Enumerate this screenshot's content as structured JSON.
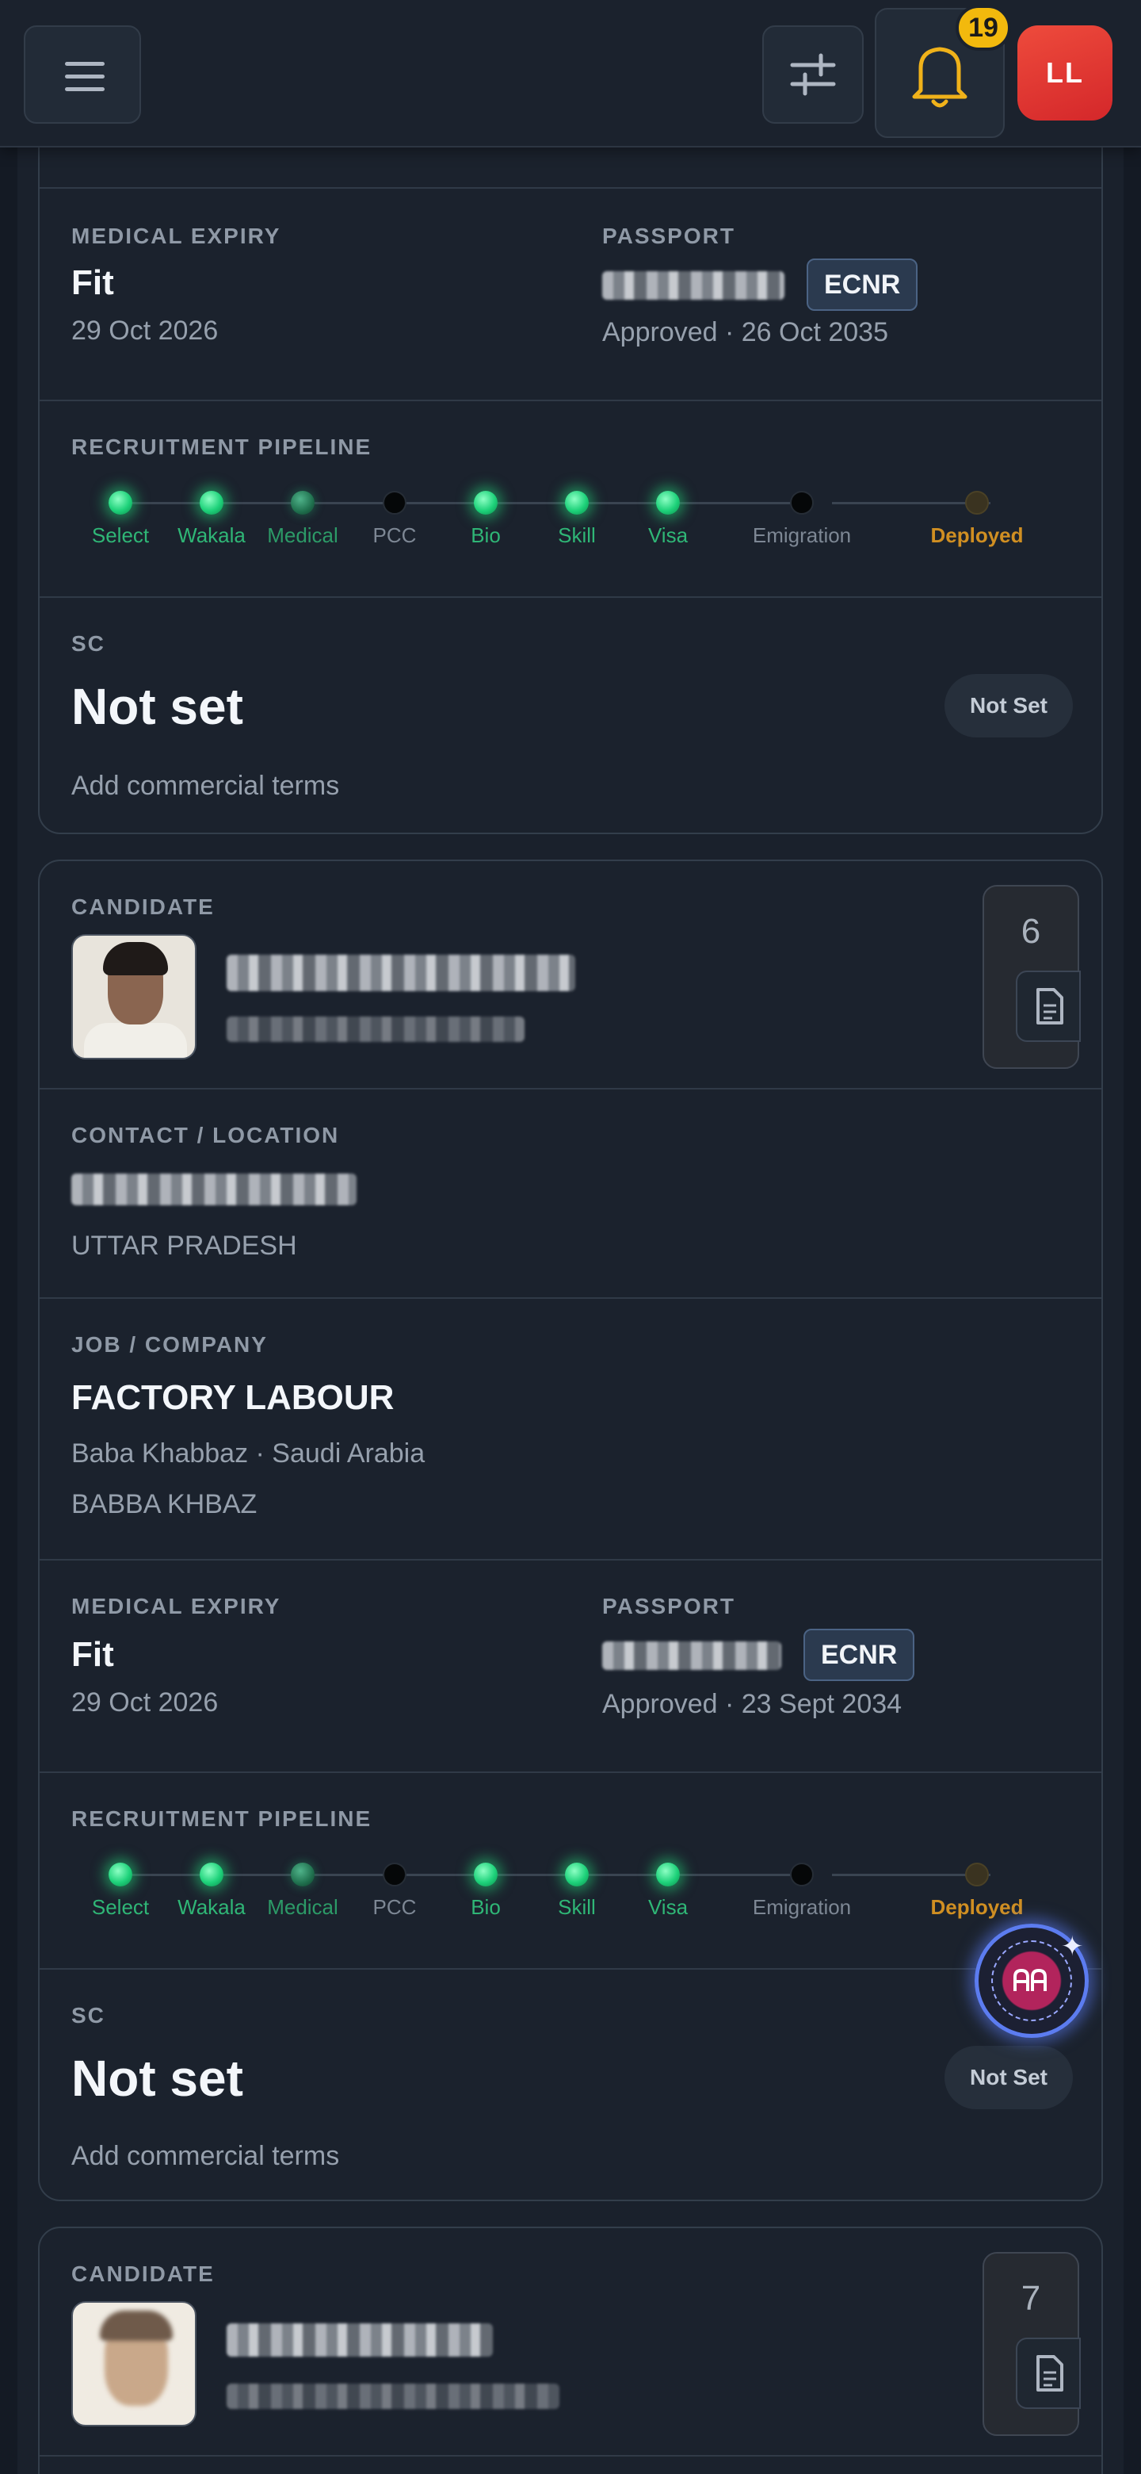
{
  "topbar": {
    "notification_count": "19",
    "avatar_initials": "LL"
  },
  "cards": [
    {
      "medical": {
        "label": "MEDICAL EXPIRY",
        "status": "Fit",
        "date": "29 Oct 2026"
      },
      "passport": {
        "label": "PASSPORT",
        "badge": "ECNR",
        "status_line": "Approved · 26 Oct 2035"
      },
      "pipeline": {
        "label": "RECRUITMENT PIPELINE",
        "stages": [
          {
            "name": "Select",
            "state": "done"
          },
          {
            "name": "Wakala",
            "state": "done"
          },
          {
            "name": "Medical",
            "state": "partial"
          },
          {
            "name": "PCC",
            "state": "pending"
          },
          {
            "name": "Bio",
            "state": "done"
          },
          {
            "name": "Skill",
            "state": "done"
          },
          {
            "name": "Visa",
            "state": "done"
          },
          {
            "name": "Emigration",
            "state": "pending"
          },
          {
            "name": "Deployed",
            "state": "final"
          }
        ]
      },
      "sc": {
        "label": "SC",
        "value": "Not set",
        "pill": "Not Set",
        "hint": "Add commercial terms"
      }
    },
    {
      "candidate": {
        "label": "CANDIDATE",
        "number": "6"
      },
      "contact": {
        "label": "CONTACT / LOCATION",
        "location": "UTTAR PRADESH"
      },
      "job": {
        "label": "JOB / COMPANY",
        "title": "FACTORY LABOUR",
        "company": "Baba Khabbaz · Saudi Arabia",
        "sponsor": "BABBA KHBAZ"
      },
      "medical": {
        "label": "MEDICAL EXPIRY",
        "status": "Fit",
        "date": "29 Oct 2026"
      },
      "passport": {
        "label": "PASSPORT",
        "badge": "ECNR",
        "status_line": "Approved · 23 Sept 2034"
      },
      "pipeline": {
        "label": "RECRUITMENT PIPELINE",
        "stages": [
          {
            "name": "Select",
            "state": "done"
          },
          {
            "name": "Wakala",
            "state": "done"
          },
          {
            "name": "Medical",
            "state": "partial"
          },
          {
            "name": "PCC",
            "state": "pending"
          },
          {
            "name": "Bio",
            "state": "done"
          },
          {
            "name": "Skill",
            "state": "done"
          },
          {
            "name": "Visa",
            "state": "done"
          },
          {
            "name": "Emigration",
            "state": "pending"
          },
          {
            "name": "Deployed",
            "state": "final"
          }
        ]
      },
      "sc": {
        "label": "SC",
        "value": "Not set",
        "pill": "Not Set",
        "hint": "Add commercial terms"
      }
    },
    {
      "candidate": {
        "label": "CANDIDATE",
        "number": "7"
      }
    }
  ],
  "colors": {
    "accent_green": "#1ed27a",
    "deployed_orange": "#d08f22",
    "badge_yellow": "#f2b90d",
    "avatar_red": "#e3382f"
  }
}
